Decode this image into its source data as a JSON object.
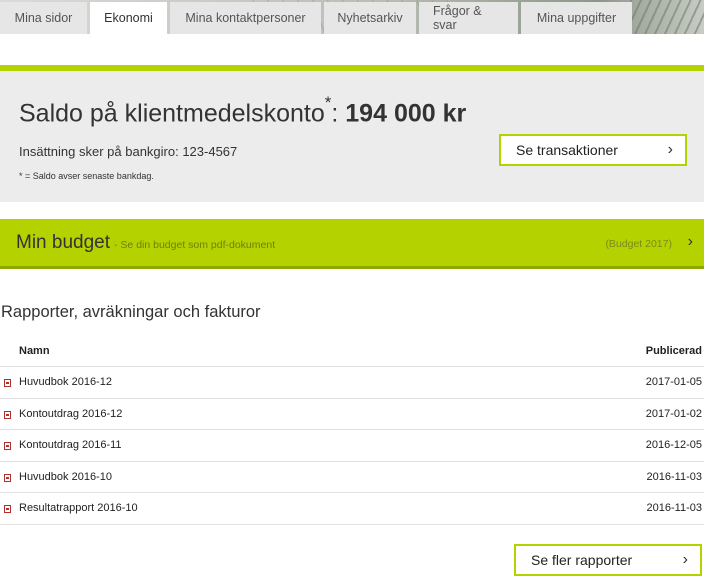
{
  "tabs": [
    {
      "label": "Mina sidor",
      "active": false
    },
    {
      "label": "Ekonomi",
      "active": true
    },
    {
      "label": "Mina kontaktpersoner",
      "active": false
    },
    {
      "label": "Nyhetsarkiv",
      "active": false
    },
    {
      "label": "Frågor & svar",
      "active": false
    },
    {
      "label": "Mina uppgifter",
      "active": false
    }
  ],
  "saldo": {
    "label": "Saldo på klientmedelskonto",
    "asterisk": "*",
    "separator": ": ",
    "amount": "194 000 kr",
    "deposit_text": "Insättning sker på bankgiro: 123-4567",
    "note": "* = Saldo avser senaste bankdag.",
    "button_label": "Se transaktioner"
  },
  "budget": {
    "title": "Min budget",
    "subtitle": "- Se din budget som pdf-dokument",
    "year_label": "(Budget 2017)"
  },
  "reports": {
    "title": "Rapporter, avräkningar och fakturor",
    "columns": {
      "name": "Namn",
      "published": "Publicerad"
    },
    "rows": [
      {
        "name": "Huvudbok 2016-12",
        "date": "2017-01-05"
      },
      {
        "name": "Kontoutdrag 2016-12",
        "date": "2017-01-02"
      },
      {
        "name": "Kontoutdrag 2016-11",
        "date": "2016-12-05"
      },
      {
        "name": "Huvudbok 2016-10",
        "date": "2016-11-03"
      },
      {
        "name": "Resultatrapport 2016-10",
        "date": "2016-11-03"
      }
    ],
    "more_button_label": "Se fler rapporter"
  },
  "icons": {
    "chevron": "chevron-right-icon",
    "file": "pdf-file-icon"
  },
  "colors": {
    "accent": "#b4d200",
    "panel": "#ececec",
    "tab": "#e6e6e6"
  }
}
